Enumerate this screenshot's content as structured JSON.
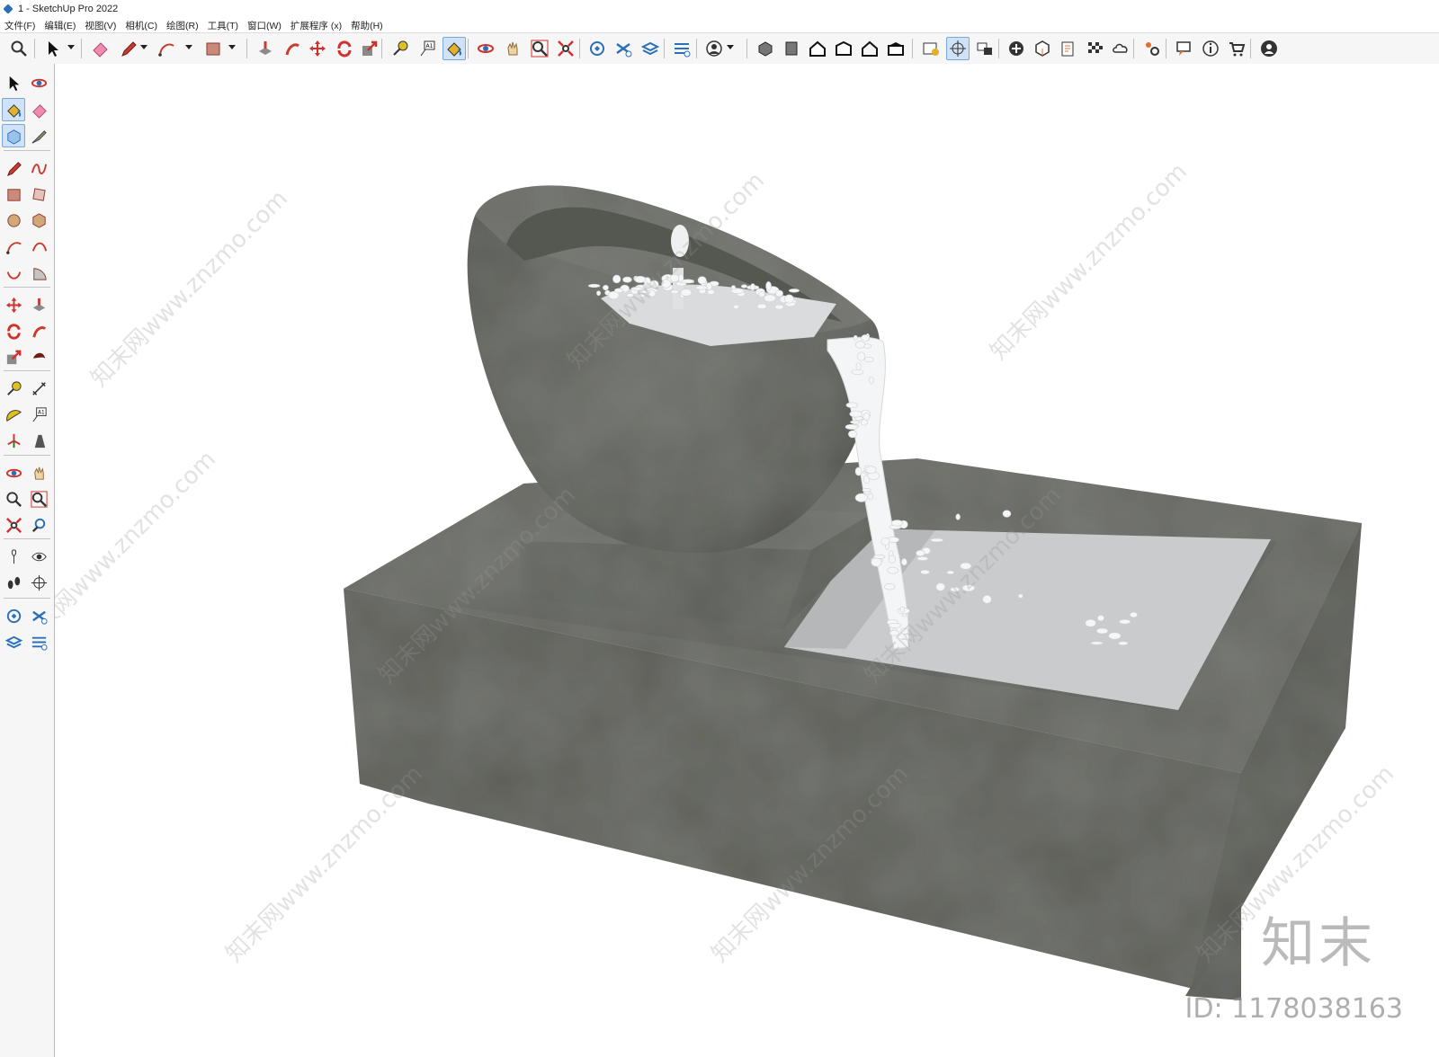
{
  "window": {
    "title": "1 - SketchUp Pro 2022"
  },
  "menu": [
    {
      "label": "文件(F)"
    },
    {
      "label": "编辑(E)"
    },
    {
      "label": "视图(V)"
    },
    {
      "label": "相机(C)"
    },
    {
      "label": "绘图(R)"
    },
    {
      "label": "工具(T)"
    },
    {
      "label": "窗口(W)"
    },
    {
      "label": "扩展程序 (x)"
    },
    {
      "label": "帮助(H)"
    }
  ],
  "toolbar": {
    "tools": [
      "zoom-icon",
      "select-icon",
      "eraser-icon",
      "pencil-icon",
      "arc-icon",
      "rectangle-icon",
      "push-pull-icon",
      "follow-me-icon",
      "move-icon",
      "rotate-icon",
      "scale-icon",
      "tape-measure-icon",
      "text-icon",
      "paint-bucket-icon",
      "orbit-icon",
      "pan-icon",
      "zoom-window-icon",
      "zoom-extents-icon",
      "warehouse-icon",
      "extension-icon",
      "layers-icon",
      "sandbox-icon",
      "account-icon",
      "3d-view-icon",
      "front-view-icon",
      "home-icon",
      "top-view-icon",
      "house-icon",
      "back-view-icon",
      "style-icon",
      "section-plane-icon",
      "scene-icon",
      "add-icon",
      "solid-icon",
      "report-icon",
      "checker-icon",
      "cloud-icon",
      "settings-icon",
      "message-icon",
      "info-icon",
      "cart-icon",
      "profile-icon"
    ],
    "active": [
      "paint-bucket-icon",
      "section-plane-icon"
    ]
  },
  "sidebar": {
    "tools": [
      "select-icon",
      "orbit-icon",
      "paint-bucket-icon",
      "eraser-icon",
      "component-icon",
      "tag-icon",
      "pencil-icon",
      "freehand-icon",
      "rectangle-icon",
      "rotated-rectangle-icon",
      "circle-icon",
      "polygon-icon",
      "arc-icon",
      "two-point-arc-icon",
      "three-point-arc-icon",
      "pie-icon",
      "move-icon",
      "push-pull-icon",
      "rotate-icon",
      "follow-me-icon",
      "scale-icon",
      "offset-icon",
      "tape-measure-icon",
      "dimension-icon",
      "protractor-icon",
      "text-icon",
      "axes-icon",
      "3d-text-icon",
      "orbit-icon",
      "pan-icon",
      "zoom-icon",
      "zoom-window-icon",
      "zoom-extents-icon",
      "previous-view-icon",
      "position-camera-icon",
      "look-around-icon",
      "walk-icon",
      "section-plane-icon",
      "warehouse-icon",
      "extension-icon",
      "layers-icon",
      "sandbox-icon"
    ],
    "active": [
      "paint-bucket-icon",
      "component-icon"
    ]
  },
  "watermark": {
    "text": "知末网www.znzmo.com",
    "logo": "知末",
    "id_label": "ID: 1178038163"
  },
  "colors": {
    "stone": "#5a5c56",
    "stone_dark": "#4a4c47",
    "stone_light": "#6e706a",
    "water": "#c9cbcd",
    "splash": "#f4f6f7",
    "active_bg": "#cfe2f7",
    "accent_red": "#d0312d"
  }
}
